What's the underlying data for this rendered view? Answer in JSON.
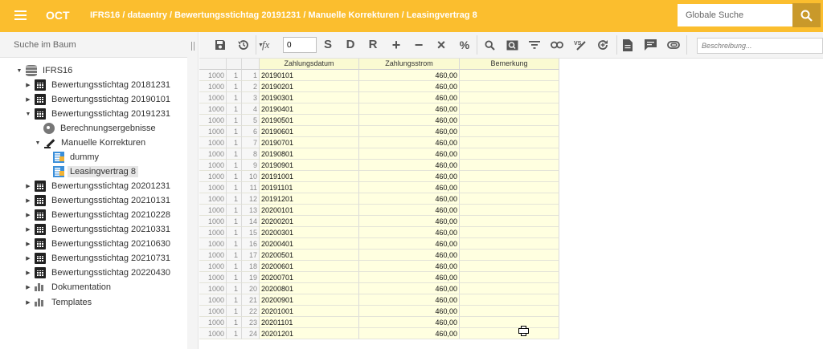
{
  "header": {
    "app_name": "OCT",
    "breadcrumb": "IFRS16 / dataentry / Bewertungsstichtag 20191231 / Manuelle Korrekturen / Leasingvertrag 8",
    "search_placeholder": "Globale Suche",
    "accent_color": "#FBBE2E"
  },
  "left_panel": {
    "search_placeholder": "Suche im Baum",
    "tree": [
      {
        "label": "IFRS16",
        "icon": "database-icon",
        "expanded": true
      },
      {
        "label": "Bewertungsstichtag 20181231",
        "icon": "calendar-icon",
        "expanded": false
      },
      {
        "label": "Bewertungsstichtag 20190101",
        "icon": "calendar-icon",
        "expanded": false
      },
      {
        "label": "Bewertungsstichtag 20191231",
        "icon": "calendar-icon",
        "expanded": true
      },
      {
        "label": "Berechnungsergebnisse",
        "icon": "gear-icon"
      },
      {
        "label": "Manuelle Korrekturen",
        "icon": "edit-icon",
        "expanded": true
      },
      {
        "label": "dummy",
        "icon": "sheet-icon"
      },
      {
        "label": "Leasingvertrag 8",
        "icon": "sheet-icon",
        "selected": true
      },
      {
        "label": "Bewertungsstichtag 20201231",
        "icon": "calendar-icon",
        "expanded": false
      },
      {
        "label": "Bewertungsstichtag 20210131",
        "icon": "calendar-icon",
        "expanded": false
      },
      {
        "label": "Bewertungsstichtag 20210228",
        "icon": "calendar-icon",
        "expanded": false
      },
      {
        "label": "Bewertungsstichtag 20210331",
        "icon": "calendar-icon",
        "expanded": false
      },
      {
        "label": "Bewertungsstichtag 20210630",
        "icon": "calendar-icon",
        "expanded": false
      },
      {
        "label": "Bewertungsstichtag 20210731",
        "icon": "calendar-icon",
        "expanded": false
      },
      {
        "label": "Bewertungsstichtag 20220430",
        "icon": "calendar-icon",
        "expanded": false
      },
      {
        "label": "Dokumentation",
        "icon": "bar-chart-icon",
        "expanded": false
      },
      {
        "label": "Templates",
        "icon": "bar-chart-icon",
        "expanded": false
      }
    ]
  },
  "toolbar": {
    "number_value": "0",
    "description_placeholder": "Beschreibung...",
    "letters": {
      "s": "S",
      "d": "D",
      "r": "R"
    },
    "symbols": {
      "plus": "+",
      "minus": "−",
      "times": "×",
      "percent": "%"
    },
    "fx_label": "fx"
  },
  "grid": {
    "columns": [
      "Zahlungsdatum",
      "Zahlungsstrom",
      "Bemerkung"
    ],
    "rows": [
      [
        "1000",
        "1",
        "1",
        "20190101",
        "460,00",
        ""
      ],
      [
        "1000",
        "1",
        "2",
        "20190201",
        "460,00",
        ""
      ],
      [
        "1000",
        "1",
        "3",
        "20190301",
        "460,00",
        ""
      ],
      [
        "1000",
        "1",
        "4",
        "20190401",
        "460,00",
        ""
      ],
      [
        "1000",
        "1",
        "5",
        "20190501",
        "460,00",
        ""
      ],
      [
        "1000",
        "1",
        "6",
        "20190601",
        "460,00",
        ""
      ],
      [
        "1000",
        "1",
        "7",
        "20190701",
        "460,00",
        ""
      ],
      [
        "1000",
        "1",
        "8",
        "20190801",
        "460,00",
        ""
      ],
      [
        "1000",
        "1",
        "9",
        "20190901",
        "460,00",
        ""
      ],
      [
        "1000",
        "1",
        "10",
        "20191001",
        "460,00",
        ""
      ],
      [
        "1000",
        "1",
        "11",
        "20191101",
        "460,00",
        ""
      ],
      [
        "1000",
        "1",
        "12",
        "20191201",
        "460,00",
        ""
      ],
      [
        "1000",
        "1",
        "13",
        "20200101",
        "460,00",
        ""
      ],
      [
        "1000",
        "1",
        "14",
        "20200201",
        "460,00",
        ""
      ],
      [
        "1000",
        "1",
        "15",
        "20200301",
        "460,00",
        ""
      ],
      [
        "1000",
        "1",
        "16",
        "20200401",
        "460,00",
        ""
      ],
      [
        "1000",
        "1",
        "17",
        "20200501",
        "460,00",
        ""
      ],
      [
        "1000",
        "1",
        "18",
        "20200601",
        "460,00",
        ""
      ],
      [
        "1000",
        "1",
        "19",
        "20200701",
        "460,00",
        ""
      ],
      [
        "1000",
        "1",
        "20",
        "20200801",
        "460,00",
        ""
      ],
      [
        "1000",
        "1",
        "21",
        "20200901",
        "460,00",
        ""
      ],
      [
        "1000",
        "1",
        "22",
        "20201001",
        "460,00",
        ""
      ],
      [
        "1000",
        "1",
        "23",
        "20201101",
        "460,00",
        ""
      ],
      [
        "1000",
        "1",
        "24",
        "20201201",
        "460,00",
        ""
      ]
    ]
  }
}
